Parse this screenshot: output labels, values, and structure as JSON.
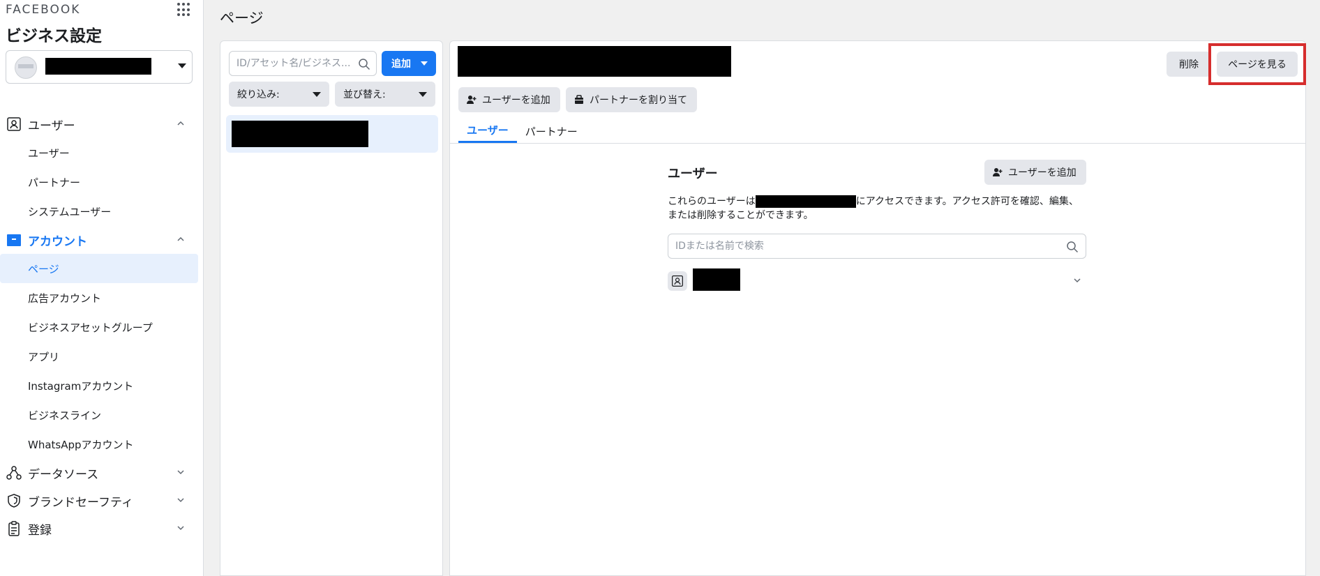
{
  "brand": "FACEBOOK",
  "sidebar": {
    "title": "ビジネス設定",
    "sections": [
      {
        "label": "ユーザー",
        "expanded": true,
        "items": [
          "ユーザー",
          "パートナー",
          "システムユーザー"
        ]
      },
      {
        "label": "アカウント",
        "expanded": true,
        "active": true,
        "items": [
          "ページ",
          "広告アカウント",
          "ビジネスアセットグループ",
          "アプリ",
          "Instagramアカウント",
          "ビジネスライン",
          "WhatsAppアカウント"
        ]
      },
      {
        "label": "データソース",
        "expanded": false
      },
      {
        "label": "ブランドセーフティ",
        "expanded": false
      },
      {
        "label": "登録",
        "expanded": false
      }
    ],
    "selected_item": "ページ"
  },
  "main": {
    "title": "ページ"
  },
  "list_panel": {
    "search_placeholder": "ID/アセット名/ビジネス...",
    "add_label": "追加",
    "filter_label": "絞り込み:",
    "sort_label": "並び替え:"
  },
  "detail": {
    "delete_label": "削除",
    "view_page_label": "ページを見る",
    "add_user_label": "ユーザーを追加",
    "assign_partner_label": "パートナーを割り当て",
    "tabs": [
      "ユーザー",
      "パートナー"
    ],
    "active_tab": "ユーザー",
    "users_title": "ユーザー",
    "users_add_label": "ユーザーを追加",
    "desc_before": "これらのユーザーは",
    "desc_after": "にアクセスできます。アクセス許可を確認、編集、または削除することができます。",
    "user_search_placeholder": "IDまたは名前で検索"
  },
  "colors": {
    "accent": "#1877f2",
    "highlight": "#d62d2d"
  }
}
